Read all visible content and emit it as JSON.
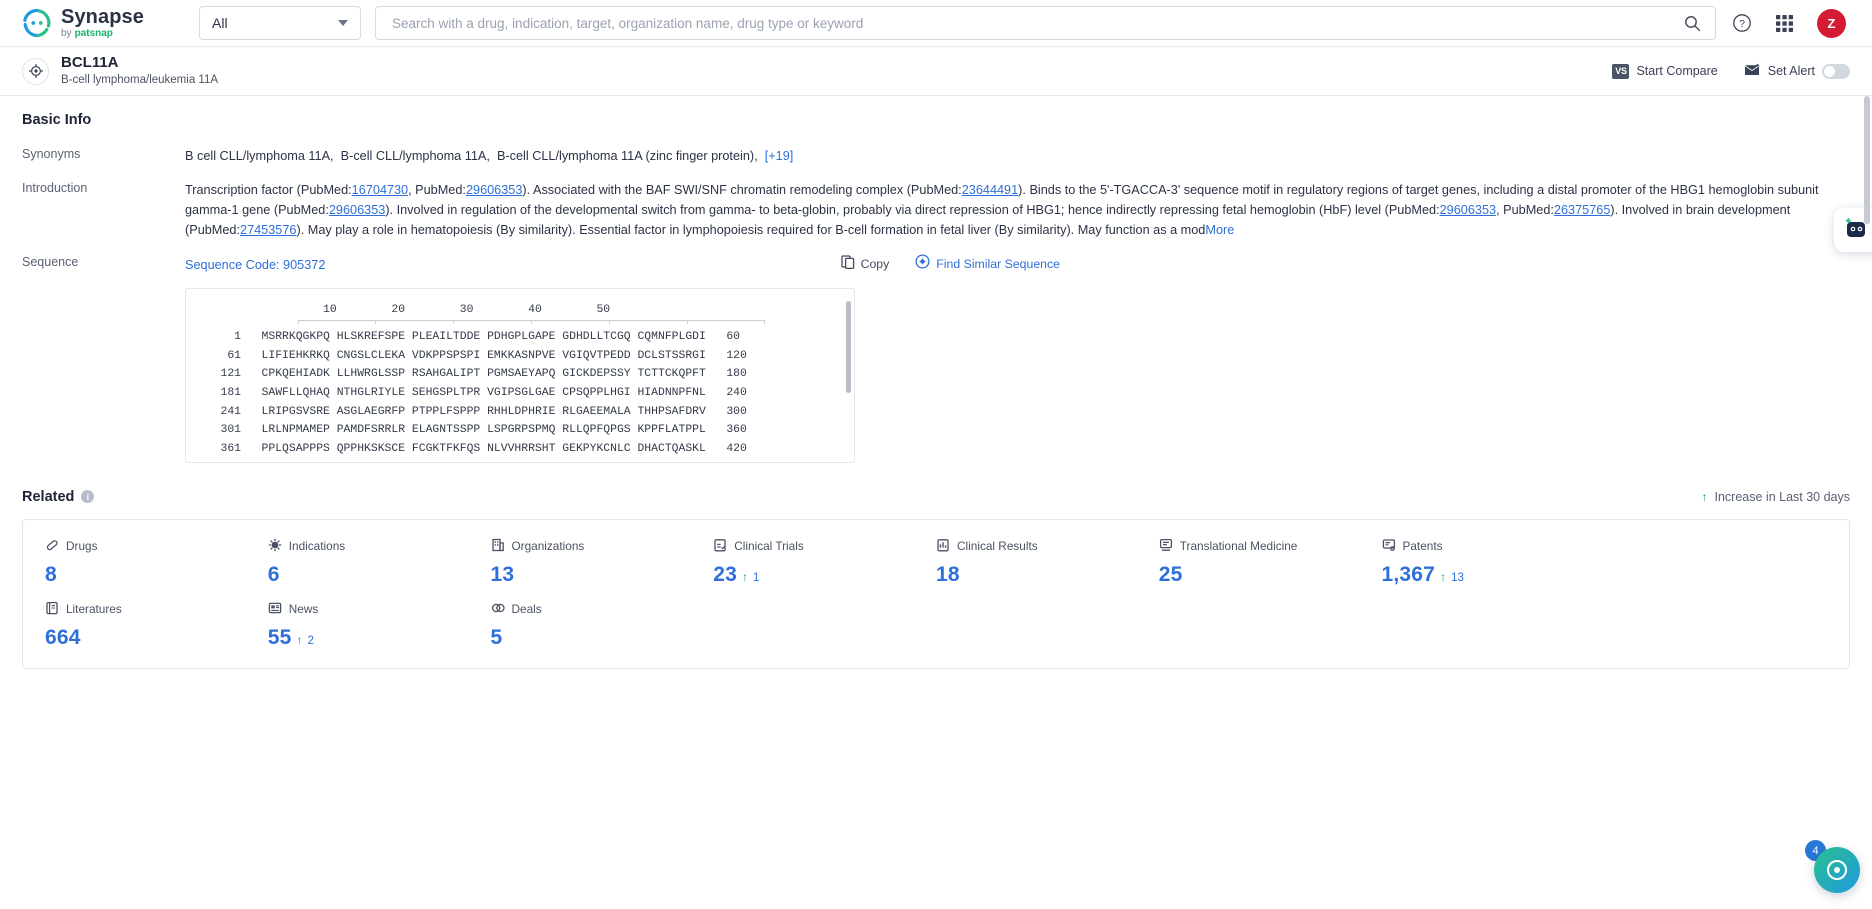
{
  "topbar": {
    "brand_name": "Synapse",
    "brand_by": "by",
    "brand_company": "patsnap",
    "category_select": "All",
    "search_placeholder": "Search with a drug, indication, target, organization name, drug type or keyword",
    "help_icon": "help-circle-icon",
    "apps_icon": "grid-apps-icon",
    "avatar_initial": "Z"
  },
  "pagehead": {
    "icon": "target-icon",
    "title": "BCL11A",
    "subtitle": "B-cell lymphoma/leukemia 11A",
    "compare_label": "Start Compare",
    "compare_badge": "VS",
    "alert_label": "Set Alert",
    "alert_icon": "envelope-alert-icon"
  },
  "basic_info": {
    "section_title": "Basic Info",
    "synonyms_label": "Synonyms",
    "synonyms": [
      "B cell CLL/lymphoma 11A,",
      "B-cell CLL/lymphoma 11A,",
      "B-cell CLL/lymphoma 11A (zinc finger protein),"
    ],
    "synonyms_more": "[+19]",
    "introduction_label": "Introduction",
    "introduction_parts": [
      {
        "t": "Transcription factor (PubMed:"
      },
      {
        "t": "16704730",
        "link": true
      },
      {
        "t": ", PubMed:"
      },
      {
        "t": "29606353",
        "link": true
      },
      {
        "t": "). Associated with the BAF SWI/SNF chromatin remodeling complex (PubMed:"
      },
      {
        "t": "23644491",
        "link": true
      },
      {
        "t": "). Binds to the 5'-TGACCA-3' sequence motif in regulatory regions of target genes, including a distal promoter of the HBG1 hemoglobin subunit gamma-1 gene (PubMed:"
      },
      {
        "t": "29606353",
        "link": true
      },
      {
        "t": "). Involved in regulation of the developmental switch from gamma- to beta-globin, probably via direct repression of HBG1; hence indirectly repressing fetal hemoglobin (HbF) level (PubMed:"
      },
      {
        "t": "29606353",
        "link": true
      },
      {
        "t": ", PubMed:"
      },
      {
        "t": "26375765",
        "link": true
      },
      {
        "t": "). Involved in brain development (PubMed:"
      },
      {
        "t": "27453576",
        "link": true
      },
      {
        "t": "). May play a role in hematopoiesis (By similarity). Essential factor in lymphopoiesis required for B-cell formation in fetal liver (By similarity). May function as a mod"
      }
    ],
    "introduction_more": "More"
  },
  "sequence": {
    "label": "Sequence",
    "code_text": "Sequence Code: 905372",
    "copy_label": "Copy",
    "copy_icon": "copy-icon",
    "find_label": "Find Similar Sequence",
    "find_icon": "similar-sequence-icon",
    "ruler_ticks": [
      "10",
      "20",
      "30",
      "40",
      "50"
    ],
    "rows": [
      {
        "start": "1",
        "blocks": [
          "MSRRKQGKPQ",
          "HLSKREFSPE",
          "PLEAILTDDE",
          "PDHGPLGAPE",
          "GDHDLLTCGQ",
          "CQMNFPLGDI"
        ],
        "end": "60"
      },
      {
        "start": "61",
        "blocks": [
          "LIFIEHKRKQ",
          "CNGSLCLEKA",
          "VDKPPSPSPI",
          "EMKKASNPVE",
          "VGIQVTPEDD",
          "DCLSTSSRGI"
        ],
        "end": "120"
      },
      {
        "start": "121",
        "blocks": [
          "CPKQEHIADK",
          "LLHWRGLSSP",
          "RSAHGALIPT",
          "PGMSAEYAPQ",
          "GICKDEPSSY",
          "TCTTCKQPFT"
        ],
        "end": "180"
      },
      {
        "start": "181",
        "blocks": [
          "SAWFLLQHAQ",
          "NTHGLRIYLE",
          "SEHGSPLTPR",
          "VGIPSGLGAE",
          "CPSQPPLHGI",
          "HIADNNPFNL"
        ],
        "end": "240"
      },
      {
        "start": "241",
        "blocks": [
          "LRIPGSVSRE",
          "ASGLAEGRFP",
          "PTPPLFSPPP",
          "RHHLDPHRIE",
          "RLGAEEMALA",
          "THHPSAFDRV"
        ],
        "end": "300"
      },
      {
        "start": "301",
        "blocks": [
          "LRLNPMAMEP",
          "PAMDFSRRLR",
          "ELAGNTSSPP",
          "LSPGRPSPMQ",
          "RLLQPFQPGS",
          "KPPFLATPPL"
        ],
        "end": "360"
      },
      {
        "start": "361",
        "blocks": [
          "PPLQSAPPPS",
          "QPPHKSKSCE",
          "FCGKTFKFQS",
          "NLVVHRRSHT",
          "GEKPYKCNLC",
          "DHACTQASKL"
        ],
        "end": "420"
      }
    ]
  },
  "related": {
    "title": "Related",
    "info_icon": "info-icon",
    "legend": "Increase in Last 30 days",
    "legend_icon": "arrow-up-icon",
    "items": [
      {
        "label": "Drugs",
        "icon": "pill-icon",
        "value": "8",
        "delta": ""
      },
      {
        "label": "Indications",
        "icon": "virus-icon",
        "value": "6",
        "delta": ""
      },
      {
        "label": "Organizations",
        "icon": "building-icon",
        "value": "13",
        "delta": ""
      },
      {
        "label": "Clinical Trials",
        "icon": "clipboard-icon",
        "value": "23",
        "delta": "1"
      },
      {
        "label": "Clinical Results",
        "icon": "results-icon",
        "value": "18",
        "delta": ""
      },
      {
        "label": "Translational Medicine",
        "icon": "microscope-icon",
        "value": "25",
        "delta": ""
      },
      {
        "label": "Patents",
        "icon": "patent-icon",
        "value": "1,367",
        "delta": "13"
      },
      {
        "label": "",
        "icon": "",
        "value": "",
        "delta": ""
      },
      {
        "label": "Literatures",
        "icon": "book-icon",
        "value": "664",
        "delta": ""
      },
      {
        "label": "News",
        "icon": "news-icon",
        "value": "55",
        "delta": "2"
      },
      {
        "label": "Deals",
        "icon": "deal-icon",
        "value": "5",
        "delta": ""
      }
    ]
  },
  "floating": {
    "chat_icon": "chat-assistant-icon",
    "fab_icon": "assistant-fab-icon",
    "fab_badge": "4"
  },
  "colors": {
    "accent_blue": "#2e6fd9",
    "avatar_red": "#d31b35",
    "increase_green": "#19a74a",
    "text_dark": "#1d2433"
  }
}
